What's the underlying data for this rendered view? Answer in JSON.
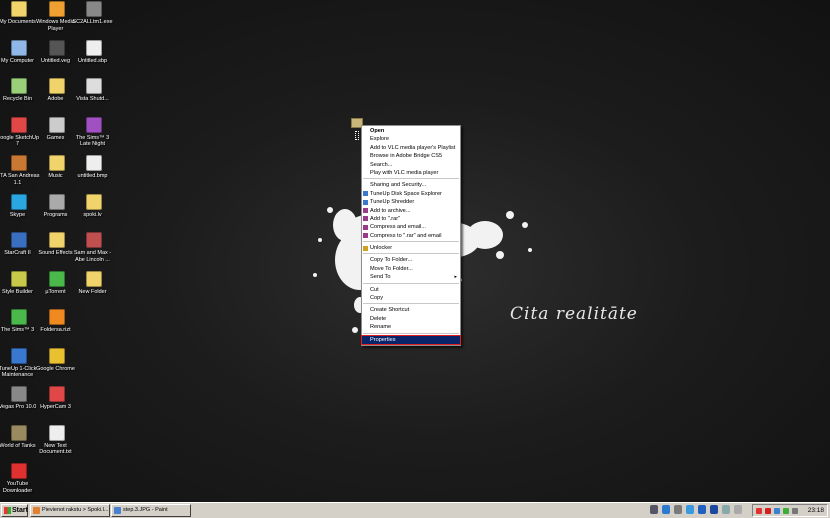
{
  "wallpaper": {
    "caption": "Cita realitāte"
  },
  "desktop_icons": [
    {
      "label": "My Documents",
      "icon": "folder-docs-icon",
      "color": "#f1d36b"
    },
    {
      "label": "My Computer",
      "icon": "computer-icon",
      "color": "#8fb7e8"
    },
    {
      "label": "Recycle Bin",
      "icon": "recycle-bin-icon",
      "color": "#9bd07a"
    },
    {
      "label": "Google SketchUp 7",
      "icon": "sketchup-icon",
      "color": "#e04848"
    },
    {
      "label": "MTA San Andreas 1.1",
      "icon": "mta-icon",
      "color": "#c87832"
    },
    {
      "label": "Skype",
      "icon": "skype-icon",
      "color": "#2aa7e0"
    },
    {
      "label": "StarCraft II",
      "icon": "starcraft-icon",
      "color": "#3a6fc0"
    },
    {
      "label": "Style Builder",
      "icon": "style-builder-icon",
      "color": "#c8c84a"
    },
    {
      "label": "The Sims™ 3",
      "icon": "sims-icon",
      "color": "#4ab84a"
    },
    {
      "label": "TuneUp 1-Click Maintenance",
      "icon": "tuneup-icon",
      "color": "#3a78d0"
    },
    {
      "label": "Vegas Pro 10.0",
      "icon": "vegas-icon",
      "color": "#888888"
    },
    {
      "label": "World of Tanks",
      "icon": "wot-icon",
      "color": "#9a8a60"
    },
    {
      "label": "YouTube Downloader",
      "icon": "youtube-icon",
      "color": "#e03030"
    },
    {
      "label": "Windows Media Player",
      "icon": "wmp-icon",
      "color": "#f0a030"
    },
    {
      "label": "Untitled.veg",
      "icon": "veg-file-icon",
      "color": "#555555"
    },
    {
      "label": "Adobe",
      "icon": "folder-icon",
      "color": "#f1d36b"
    },
    {
      "label": "Games",
      "icon": "games-icon",
      "color": "#cccccc"
    },
    {
      "label": "Music",
      "icon": "folder-icon",
      "color": "#f1d36b"
    },
    {
      "label": "Programs",
      "icon": "programs-icon",
      "color": "#aaaaaa"
    },
    {
      "label": "Sound Effects",
      "icon": "folder-icon",
      "color": "#f1d36b"
    },
    {
      "label": "µTorrent",
      "icon": "utorrent-icon",
      "color": "#4ab84a"
    },
    {
      "label": "Foldersa.rizt",
      "icon": "vlc-icon",
      "color": "#f08a20"
    },
    {
      "label": "Google Chrome",
      "icon": "chrome-icon",
      "color": "#e8c030"
    },
    {
      "label": "HyperCam 3",
      "icon": "hypercam-icon",
      "color": "#e04848"
    },
    {
      "label": "New Text Document.txt",
      "icon": "text-file-icon",
      "color": "#eeeeee"
    },
    {
      "label": "SC2ALLtm1.exe",
      "icon": "exe-icon",
      "color": "#888888"
    },
    {
      "label": "Untitled.sbp",
      "icon": "file-icon",
      "color": "#eeeeee"
    },
    {
      "label": "Vista Shutd...",
      "icon": "shutdown-icon",
      "color": "#dddddd"
    },
    {
      "label": "The Sims™ 3 Late Night",
      "icon": "sims-late-night-icon",
      "color": "#a050c0"
    },
    {
      "label": "untitled.bmp",
      "icon": "bmp-file-icon",
      "color": "#eeeeee"
    },
    {
      "label": "spoki.lv",
      "icon": "folder-icon",
      "color": "#f1d36b"
    },
    {
      "label": "Sam and Max - Abe Lincoln ...",
      "icon": "game-icon",
      "color": "#c05050"
    },
    {
      "label": "New Folder",
      "icon": "folder-icon",
      "color": "#f1d36b"
    },
    {
      "label": "step.3.JPG",
      "icon": "image-file-icon",
      "color": "#dddddd"
    }
  ],
  "context_menu": {
    "groups": [
      [
        {
          "label": "Open",
          "bold": true
        },
        {
          "label": "Explore"
        },
        {
          "label": "Add to VLC media player's Playlist"
        },
        {
          "label": "Browse in Adobe Bridge CS5"
        },
        {
          "label": "Search..."
        },
        {
          "label": "Play with VLC media player"
        }
      ],
      [
        {
          "label": "Sharing and Security..."
        },
        {
          "label": "TuneUp Disk Space Explorer",
          "icon": "tuneup-icon"
        },
        {
          "label": "TuneUp Shredder",
          "icon": "tuneup-icon"
        },
        {
          "label": "Add to archive...",
          "icon": "winrar-icon"
        },
        {
          "label": "Add to \".rar\"",
          "icon": "winrar-icon"
        },
        {
          "label": "Compress and email...",
          "icon": "winrar-icon"
        },
        {
          "label": "Compress to \".rar\" and email",
          "icon": "winrar-icon"
        }
      ],
      [
        {
          "label": "Unlocker",
          "icon": "unlocker-icon"
        }
      ],
      [
        {
          "label": "Copy To Folder..."
        },
        {
          "label": "Move To Folder..."
        },
        {
          "label": "Send To",
          "submenu": true
        }
      ],
      [
        {
          "label": "Cut"
        },
        {
          "label": "Copy"
        }
      ],
      [
        {
          "label": "Create Shortcut"
        },
        {
          "label": "Delete"
        },
        {
          "label": "Rename"
        }
      ],
      [
        {
          "label": "Properties",
          "highlight": true
        }
      ]
    ]
  },
  "taskbar": {
    "start_label": "Start",
    "tasks": [
      {
        "label": "Pievienot rakstu > Spoki.l...",
        "icon": "browser-icon",
        "color": "#e08030"
      },
      {
        "label": "step.3.JPG - Paint",
        "icon": "paint-icon",
        "color": "#4a80d0"
      }
    ],
    "clock": "23:18"
  }
}
